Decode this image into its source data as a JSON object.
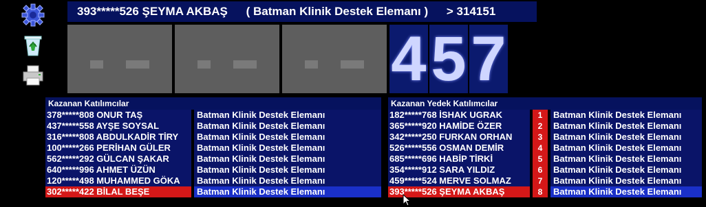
{
  "header": {
    "participant": "393*****526 ŞEYMA AKBAŞ",
    "role": "( Batman Klinik Destek Elemanı )",
    "count": "> 314151"
  },
  "digits": {
    "hidden_count": 6,
    "shown": [
      "4",
      "5",
      "7"
    ]
  },
  "sidebar": {
    "icons": [
      "gear-icon",
      "recycle-bin-icon",
      "printer-icon"
    ]
  },
  "winners": {
    "title": "Kazanan Katılımcılar",
    "rows": [
      {
        "name": "378*****808 ONUR TAŞ",
        "role": "Batman Klinik Destek Elemanı"
      },
      {
        "name": "437*****558 AYŞE SOYSAL",
        "role": "Batman Klinik Destek Elemanı"
      },
      {
        "name": "316*****808 ABDULKADİR TİRY",
        "role": "Batman Klinik Destek Elemanı"
      },
      {
        "name": "100*****266 PERİHAN GÜLER",
        "role": "Batman Klinik Destek Elemanı"
      },
      {
        "name": "562*****292 GÜLCAN ŞAKAR",
        "role": "Batman Klinik Destek Elemanı"
      },
      {
        "name": "640*****996 AHMET ÜZÜN",
        "role": "Batman Klinik Destek Elemanı"
      },
      {
        "name": "120*****498 MUHAMMED GÖKA",
        "role": "Batman Klinik Destek Elemanı"
      },
      {
        "name": "302*****422 BİLAL BEŞE",
        "role": "Batman Klinik Destek Elemanı"
      }
    ]
  },
  "reserves": {
    "title": "Kazanan Yedek Katılımcılar",
    "rows": [
      {
        "name": "182*****768 İSHAK UGRAK",
        "rank": "1",
        "role": "Batman Klinik Destek Elemanı"
      },
      {
        "name": "365*****920 HAMİDE ÖZER",
        "rank": "2",
        "role": "Batman Klinik Destek Elemanı"
      },
      {
        "name": "342*****250 FURKAN ORHAN",
        "rank": "3",
        "role": "Batman Klinik Destek Elemanı"
      },
      {
        "name": "526*****556 OSMAN DEMİR",
        "rank": "4",
        "role": "Batman Klinik Destek Elemanı"
      },
      {
        "name": "685*****696 HABİP TİRKİ",
        "rank": "5",
        "role": "Batman Klinik Destek Elemanı"
      },
      {
        "name": "354*****912 SARA YILDIZ",
        "rank": "6",
        "role": "Batman Klinik Destek Elemanı"
      },
      {
        "name": "459*****524 MERVE SOLMAZ",
        "rank": "7",
        "role": "Batman Klinik Destek Elemanı"
      },
      {
        "name": "393*****526 ŞEYMA AKBAŞ",
        "rank": "8",
        "role": "Batman Klinik Destek Elemanı"
      }
    ]
  },
  "colors": {
    "accent_red": "#d41818",
    "header_blue": "#06125e",
    "highlight_blue": "#1a30c8"
  }
}
